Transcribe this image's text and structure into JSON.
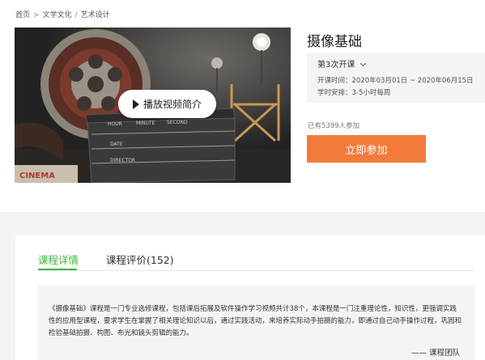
{
  "breadcrumb": [
    "首页",
    "文学文化",
    "艺术设计"
  ],
  "breadcrumb_sep_first": ">",
  "breadcrumb_sep": "/",
  "video": {
    "play_label": "播放视频简介",
    "slate_labels": [
      "HOUR",
      "MINUTE",
      "SECOND",
      "DATE",
      "DIRECTOR"
    ],
    "sign_text": "CINEMA"
  },
  "course": {
    "title": "摄像基础",
    "term": "第3次开课",
    "time": "开课时间：2020年03月01日 ~ 2020年06月15日",
    "hours": "学时安排：3-5小时每周",
    "enrolled": "已有5399人参加",
    "join_label": "立即参加"
  },
  "tabs": {
    "detail": "课程详情",
    "review": "课程评价(152)"
  },
  "description": {
    "text": "《摄像基础》课程是一门专业选修课程，包括课后拓展及软件操作学习视频共计38个，本课程是一门注重理论性，知识性，更强调实践性的应用型课程，要求学生在掌握了相关理论知识以后，通过实践活动，来培养实际动手拍摄的能力，即通过自己动手操作过程，巩固和检验基础拍摄、构图、布光和镜头剪辑的能力。",
    "signature": "—— 课程团队"
  },
  "colors": {
    "accent_green": "#3db83d",
    "button_orange": "#f27b3c"
  },
  "icons": [
    "play-icon",
    "chevron-down-icon"
  ]
}
